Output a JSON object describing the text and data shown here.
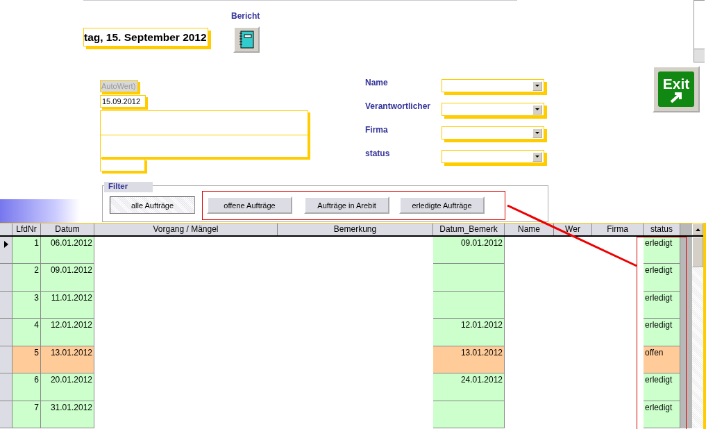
{
  "header": {
    "date": "tag, 15. September 2012",
    "report_label": "Bericht"
  },
  "record": {
    "id_placeholder": "AutoWert)",
    "date": "15.09.2012"
  },
  "lookups": [
    {
      "label": "Name"
    },
    {
      "label": "Verantwortlicher"
    },
    {
      "label": "Firma"
    },
    {
      "label": "status"
    }
  ],
  "exit_button": {
    "label": "Exit"
  },
  "filter": {
    "title": "Filter",
    "buttons": [
      {
        "label": "alle Aufträge",
        "selected": true
      },
      {
        "label": "offene Aufträge",
        "selected": false
      },
      {
        "label": "Aufträge in Arebit",
        "selected": false
      },
      {
        "label": "erledigte Aufträge",
        "selected": false
      }
    ]
  },
  "table": {
    "columns": [
      "LfdNr",
      "Datum",
      "Vorgang / Mängel",
      "Bemerkung",
      "Datum_Bemerk",
      "Name",
      "Wer",
      "Firma",
      "status"
    ],
    "rows": [
      {
        "lfdnr": "1",
        "datum": "06.01.2012",
        "datum_bemerk": "09.01.2012",
        "status": "erledigt",
        "color": "#ccffcc",
        "selected": true
      },
      {
        "lfdnr": "2",
        "datum": "09.01.2012",
        "datum_bemerk": "",
        "status": "erledigt",
        "color": "#ccffcc",
        "selected": false
      },
      {
        "lfdnr": "3",
        "datum": "11.01.2012",
        "datum_bemerk": "",
        "status": "erledigt",
        "color": "#ccffcc",
        "selected": false
      },
      {
        "lfdnr": "4",
        "datum": "12.01.2012",
        "datum_bemerk": "12.01.2012",
        "status": "erledigt",
        "color": "#ccffcc",
        "selected": false
      },
      {
        "lfdnr": "5",
        "datum": "13.01.2012",
        "datum_bemerk": "13.01.2012",
        "status": "offen",
        "color": "#ffcc99",
        "selected": false
      },
      {
        "lfdnr": "6",
        "datum": "20.01.2012",
        "datum_bemerk": "24.01.2012",
        "status": "erledigt",
        "color": "#ccffcc",
        "selected": false
      },
      {
        "lfdnr": "7",
        "datum": "31.01.2012",
        "datum_bemerk": "",
        "status": "erledigt",
        "color": "#ccffcc",
        "selected": false
      }
    ]
  }
}
